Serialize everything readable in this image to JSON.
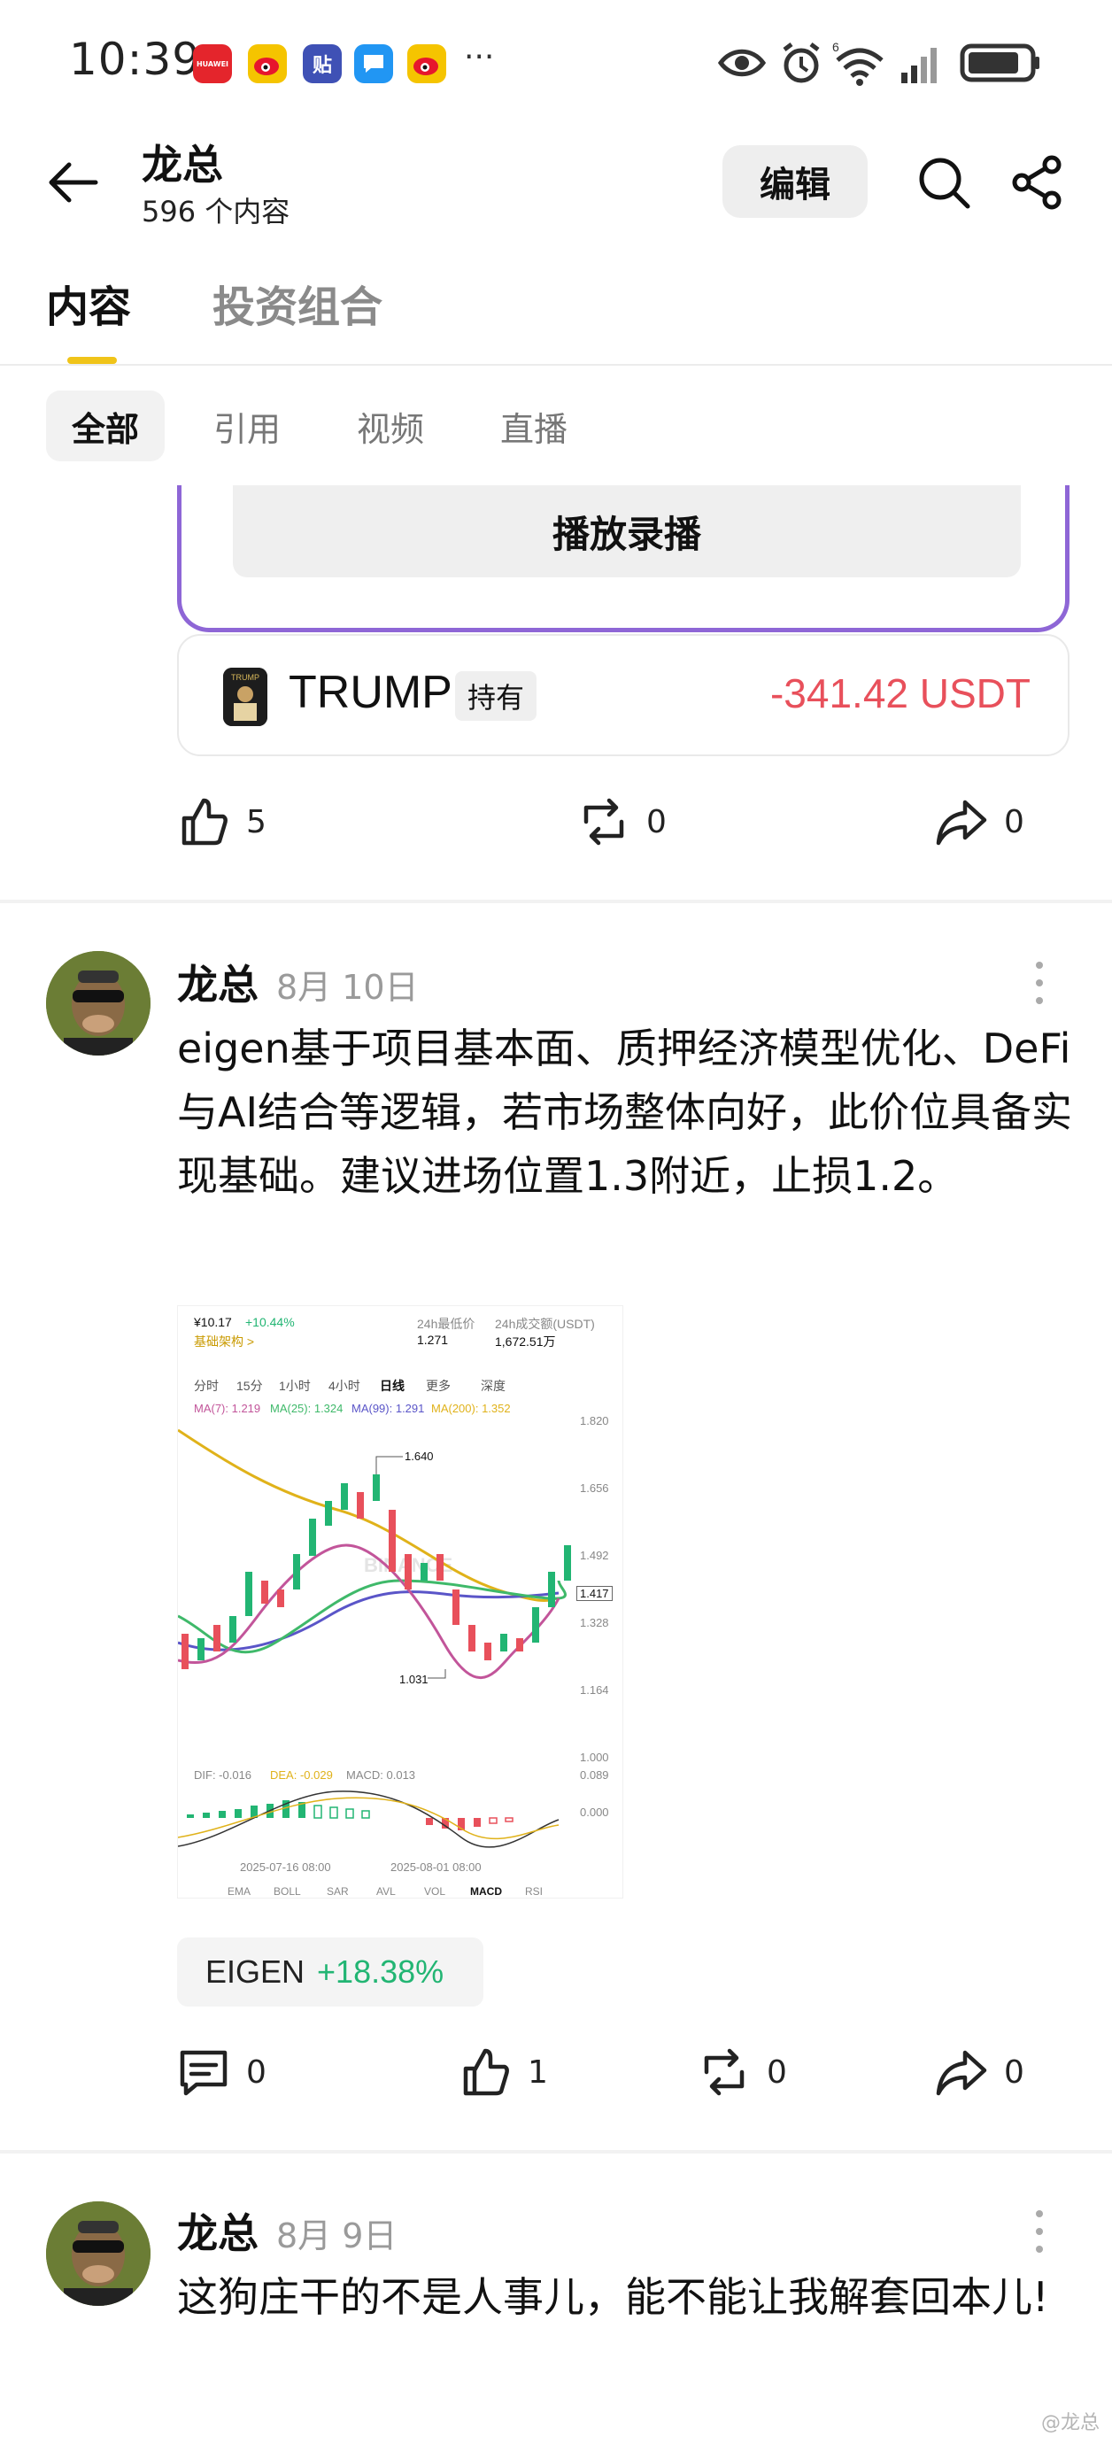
{
  "status_bar": {
    "time": "10:39",
    "apps": [
      {
        "name": "huawei-app-icon",
        "text": "HUAWEI",
        "color": "#e4252c"
      },
      {
        "name": "weibo-app-icon",
        "text": "",
        "color": "#f5c400"
      },
      {
        "name": "tieba-app-icon",
        "text": "贴",
        "color": "#3f51b5"
      },
      {
        "name": "message-app-icon",
        "text": "",
        "color": "#2196f3"
      },
      {
        "name": "weibo-app-icon-2",
        "text": "",
        "color": "#f5c400"
      }
    ],
    "more": "···",
    "network": "6"
  },
  "header": {
    "name": "龙总",
    "count": "596 个内容",
    "edit_label": "编辑"
  },
  "tabs": {
    "content": "内容",
    "portfolio": "投资组合"
  },
  "filters": [
    "全部",
    "引用",
    "视频",
    "直播"
  ],
  "post1": {
    "replay_label": "播放录播",
    "holding": {
      "symbol": "TRUMP",
      "tag": "持有",
      "pnl": "-341.42 USDT"
    },
    "likes": "5",
    "reposts": "0",
    "shares": "0"
  },
  "post2": {
    "author": "龙总",
    "date": "8月 10日",
    "body": "eigen基于项目基本面、质押经济模型优化、DeFi与AI结合等逻辑，若市场整体向好，此价位具备实现基础。建议进场位置1.3附近，止损1.2。",
    "chart_image": {
      "price": "¥10.17",
      "change": "+10.44%",
      "tag": "基础架构 >",
      "low_label": "24h最低价",
      "low": "1.271",
      "vol_label": "24h成交额(USDT)",
      "vol": "1,672.51万",
      "intervals": [
        "分时",
        "15分",
        "1小时",
        "4小时",
        "日线",
        "更多",
        "深度"
      ],
      "ma7": "MA(7): 1.219",
      "ma25": "MA(25): 1.324",
      "ma99": "MA(99): 1.291",
      "ma200": "MA(200): 1.352",
      "y_ticks": [
        "1.820",
        "1.656",
        "1.492",
        "1.328",
        "1.164",
        "1.000"
      ],
      "current_price": "1.417",
      "high_mark": "1.640",
      "low_mark": "1.031",
      "watermark": "BINANCE",
      "dif": "DIF: -0.016",
      "dea": "DEA: -0.029",
      "macd": "MACD: 0.013",
      "macd_ticks": [
        "0.089",
        "0.000"
      ],
      "dates": [
        "2025-07-16 08:00",
        "2025-08-01 08:00"
      ],
      "bottom_tabs": [
        "EMA",
        "BOLL",
        "SAR",
        "AVL",
        "VOL",
        "MACD",
        "RSI"
      ]
    },
    "ticker": {
      "symbol": "EIGEN",
      "change": "+18.38%"
    },
    "comments": "0",
    "likes": "1",
    "reposts": "0",
    "shares": "0"
  },
  "post3": {
    "author": "龙总",
    "date": "8月 9日",
    "body": "这狗庄干的不是人事儿，能不能让我解套回本儿!"
  },
  "watermark": "@龙总",
  "colors": {
    "accent_yellow": "#f0c419",
    "live_border": "#8e66d6",
    "loss_red": "#e8505b",
    "gain_green": "#22b573"
  }
}
